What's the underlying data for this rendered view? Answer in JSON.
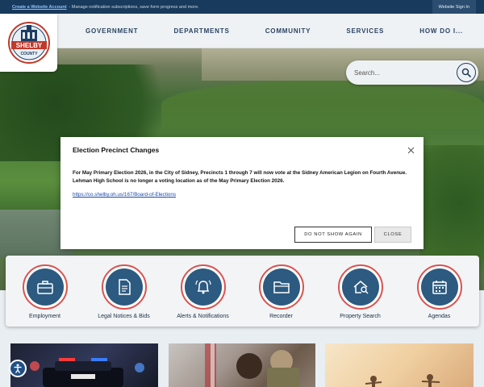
{
  "topbar": {
    "create_link": "Create a Website Account",
    "create_desc": "- Manage notification subscriptions, save form progress and more.",
    "signin": "Website Sign In"
  },
  "logo": {
    "icon": "shelby-county-seal",
    "text_top": "SHELBY",
    "text_bottom": "COUNTY"
  },
  "nav": {
    "items": [
      "GOVERNMENT",
      "DEPARTMENTS",
      "COMMUNITY",
      "SERVICES",
      "HOW DO I..."
    ]
  },
  "search": {
    "placeholder": "Search..."
  },
  "modal": {
    "title": "Election Precinct Changes",
    "body": "For May Primary Election 2026, in the City of Sidney, Precincts 1 through 7 will now vote at the Sidney American Legion on Fourth Avenue. Lehman High School is no longer a voting location as of the May Primary Election 2026.",
    "link": "https://co.shelby.oh.us/167/Board-of-Elections",
    "dont_show": "DO NOT SHOW AGAIN",
    "close": "CLOSE"
  },
  "quick_links": [
    {
      "label": "Employment",
      "icon": "briefcase-icon"
    },
    {
      "label": "Legal Notices & Bids",
      "icon": "document-icon"
    },
    {
      "label": "Alerts & Notifications",
      "icon": "bell-icon"
    },
    {
      "label": "Recorder",
      "icon": "folder-icon"
    },
    {
      "label": "Property Search",
      "icon": "house-search-icon"
    },
    {
      "label": "Agendas",
      "icon": "calendar-icon"
    }
  ],
  "colors": {
    "navy": "#183a5c",
    "accent_red": "#d9534f",
    "icon_blue": "#2c5a80"
  }
}
